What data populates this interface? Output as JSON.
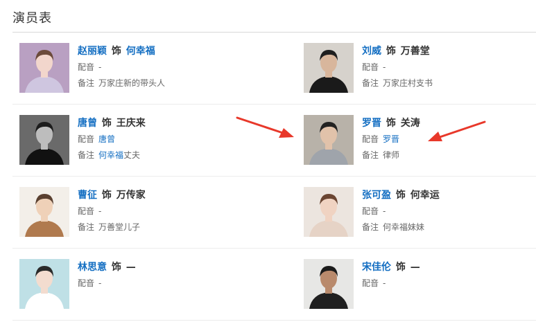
{
  "section_title": "演员表",
  "shi_label": "饰",
  "dub_label": "配音",
  "note_label": "备注",
  "cast": [
    {
      "actor": "赵丽颖",
      "role": "何幸福",
      "role_link": true,
      "dub": "-",
      "dub_link": false,
      "note": "万家庄新的带头人",
      "note_link": "",
      "photo_bg": "#b9a0c2",
      "skin": "#f2d6cc",
      "hair": "#6b4a3a",
      "cloth": "#cfc6e0"
    },
    {
      "actor": "刘威",
      "role": "万善堂",
      "role_link": false,
      "dub": "-",
      "dub_link": false,
      "note": "万家庄村支书",
      "note_link": "",
      "photo_bg": "#d6d2cc",
      "skin": "#d8b69c",
      "hair": "#1f1f1f",
      "cloth": "#1a1a1a"
    },
    {
      "actor": "唐曾",
      "role": "王庆来",
      "role_link": false,
      "dub": "唐曾",
      "dub_link": true,
      "note": "丈夫",
      "note_link": "何幸福",
      "photo_bg": "#6a6a6a",
      "skin": "#bdbdbd",
      "hair": "#1c1c1c",
      "cloth": "#111111"
    },
    {
      "actor": "罗晋",
      "role": "关涛",
      "role_link": false,
      "dub": "罗晋",
      "dub_link": true,
      "note": "律师",
      "note_link": "",
      "photo_bg": "#b8b2a9",
      "skin": "#e1c2aa",
      "hair": "#222222",
      "cloth": "#9fa4ab"
    },
    {
      "actor": "曹征",
      "role": "万传家",
      "role_link": false,
      "dub": "-",
      "dub_link": false,
      "note": "万善堂儿子",
      "note_link": "",
      "photo_bg": "#f3efe9",
      "skin": "#efd1b8",
      "hair": "#5a4030",
      "cloth": "#b07a4e"
    },
    {
      "actor": "张可盈",
      "role": "何幸运",
      "role_link": false,
      "dub": "-",
      "dub_link": false,
      "note": "何幸福妹妹",
      "note_link": "",
      "photo_bg": "#ece5df",
      "skin": "#f0d3c2",
      "hair": "#6a4532",
      "cloth": "#e6d3c6"
    },
    {
      "actor": "林思意",
      "role": "—",
      "role_link": false,
      "dub": "-",
      "dub_link": false,
      "note": "",
      "note_link": "",
      "photo_bg": "#bfe0e6",
      "skin": "#f3dccf",
      "hair": "#2a2a2a",
      "cloth": "#ffffff"
    },
    {
      "actor": "宋佳伦",
      "role": "—",
      "role_link": false,
      "dub": "-",
      "dub_link": false,
      "note": "",
      "note_link": "",
      "photo_bg": "#e7e7e5",
      "skin": "#b98a6c",
      "hair": "#1b1b1b",
      "cloth": "#202020"
    }
  ],
  "colors": {
    "link": "#136ec2",
    "arrow": "#e8382a"
  }
}
